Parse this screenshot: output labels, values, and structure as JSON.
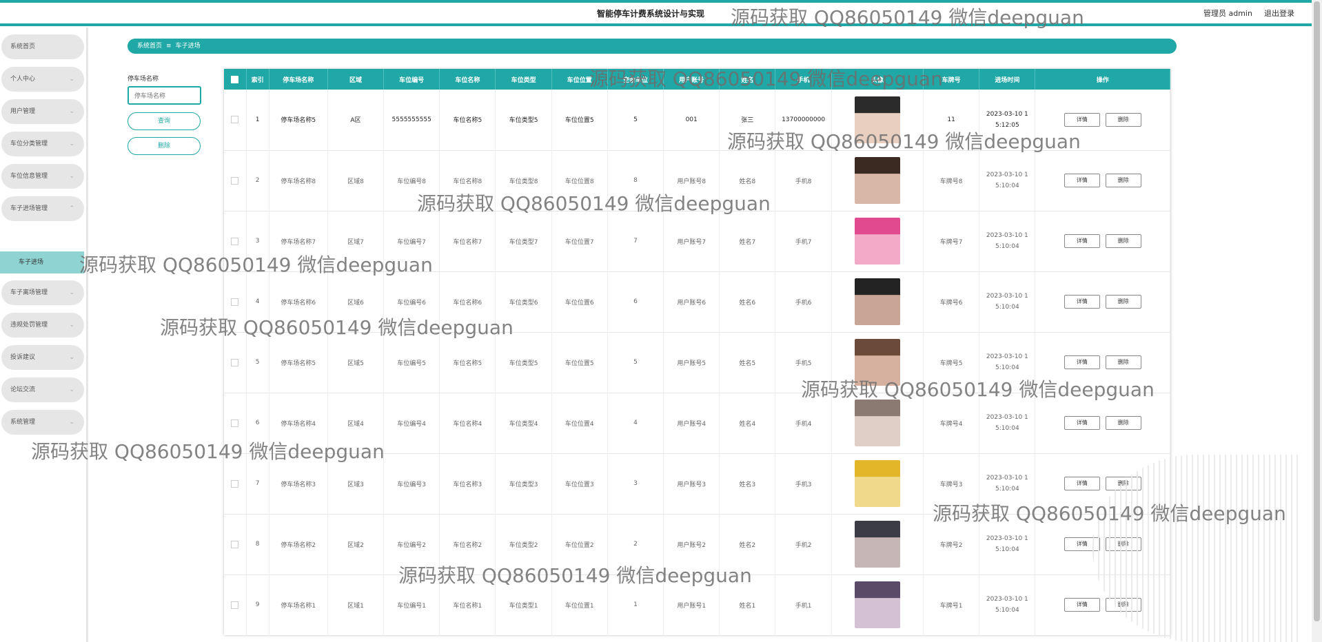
{
  "header": {
    "app_title": "智能停车计费系统设计与实现",
    "user_label": "管理员 admin",
    "logout_label": "退出登录"
  },
  "sidebar": {
    "items": [
      {
        "label": "系统首页",
        "expandable": false
      },
      {
        "label": "个人中心",
        "expandable": true
      },
      {
        "label": "用户管理",
        "expandable": true
      },
      {
        "label": "车位分类管理",
        "expandable": true
      },
      {
        "label": "车位信息管理",
        "expandable": true
      },
      {
        "label": "车子进场管理",
        "expandable": true,
        "expanded": true
      },
      {
        "label": "车子离场管理",
        "expandable": true
      },
      {
        "label": "违规处罚管理",
        "expandable": true
      },
      {
        "label": "投诉建议",
        "expandable": true
      },
      {
        "label": "论坛交流",
        "expandable": true
      },
      {
        "label": "系统管理",
        "expandable": true
      }
    ],
    "active_sub": "车子进场"
  },
  "breadcrumb": {
    "home": "系统首页",
    "current": "车子进场"
  },
  "filter": {
    "label": "停车场名称",
    "placeholder": "停车场名称",
    "search_label": "查询",
    "delete_label": "删除"
  },
  "table": {
    "columns": [
      "",
      "索引",
      "停车场名称",
      "区域",
      "车位编号",
      "车位名称",
      "车位类型",
      "车位位置",
      "空余车位",
      "用户账号",
      "姓名",
      "手机",
      "头像",
      "车牌号",
      "进场时间",
      "操作"
    ],
    "rows": [
      {
        "index": "1",
        "lot": "停车场名称5",
        "area": "A区",
        "code": "5555555555",
        "name": "车位名称5",
        "type": "车位类型5",
        "pos": "车位位置5",
        "free": "5",
        "account": "001",
        "person": "张三",
        "phone": "13700000000",
        "plate": "11",
        "time": "2023-03-10 15:12:05"
      },
      {
        "index": "2",
        "lot": "停车场名称8",
        "area": "区域8",
        "code": "车位编号8",
        "name": "车位名称8",
        "type": "车位类型8",
        "pos": "车位位置8",
        "free": "8",
        "account": "用户账号8",
        "person": "姓名8",
        "phone": "手机8",
        "plate": "车牌号8",
        "time": "2023-03-10 15:10:04"
      },
      {
        "index": "3",
        "lot": "停车场名称7",
        "area": "区域7",
        "code": "车位编号7",
        "name": "车位名称7",
        "type": "车位类型7",
        "pos": "车位位置7",
        "free": "7",
        "account": "用户账号7",
        "person": "姓名7",
        "phone": "手机7",
        "plate": "车牌号7",
        "time": "2023-03-10 15:10:04"
      },
      {
        "index": "4",
        "lot": "停车场名称6",
        "area": "区域6",
        "code": "车位编号6",
        "name": "车位名称6",
        "type": "车位类型6",
        "pos": "车位位置6",
        "free": "6",
        "account": "用户账号6",
        "person": "姓名6",
        "phone": "手机6",
        "plate": "车牌号6",
        "time": "2023-03-10 15:10:04"
      },
      {
        "index": "5",
        "lot": "停车场名称5",
        "area": "区域5",
        "code": "车位编号5",
        "name": "车位名称5",
        "type": "车位类型5",
        "pos": "车位位置5",
        "free": "5",
        "account": "用户账号5",
        "person": "姓名5",
        "phone": "手机5",
        "plate": "车牌号5",
        "time": "2023-03-10 15:10:04"
      },
      {
        "index": "6",
        "lot": "停车场名称4",
        "area": "区域4",
        "code": "车位编号4",
        "name": "车位名称4",
        "type": "车位类型4",
        "pos": "车位位置4",
        "free": "4",
        "account": "用户账号4",
        "person": "姓名4",
        "phone": "手机4",
        "plate": "车牌号4",
        "time": "2023-03-10 15:10:04"
      },
      {
        "index": "7",
        "lot": "停车场名称3",
        "area": "区域3",
        "code": "车位编号3",
        "name": "车位名称3",
        "type": "车位类型3",
        "pos": "车位位置3",
        "free": "3",
        "account": "用户账号3",
        "person": "姓名3",
        "phone": "手机3",
        "plate": "车牌号3",
        "time": "2023-03-10 15:10:04"
      },
      {
        "index": "8",
        "lot": "停车场名称2",
        "area": "区域2",
        "code": "车位编号2",
        "name": "车位名称2",
        "type": "车位类型2",
        "pos": "车位位置2",
        "free": "2",
        "account": "用户账号2",
        "person": "姓名2",
        "phone": "手机2",
        "plate": "车牌号2",
        "time": "2023-03-10 15:10:04"
      },
      {
        "index": "9",
        "lot": "停车场名称1",
        "area": "区域1",
        "code": "车位编号1",
        "name": "车位名称1",
        "type": "车位类型1",
        "pos": "车位位置1",
        "free": "1",
        "account": "用户账号1",
        "person": "姓名1",
        "phone": "手机1",
        "plate": "车牌号1",
        "time": "2023-03-10 15:10:04"
      }
    ],
    "detail_label": "详情",
    "delete_label": "删除"
  },
  "watermark_text": "源码获取 QQ86050149 微信deepguan",
  "colors": {
    "accent": "#20a8a6",
    "sub_active": "#8fd3d2",
    "menu_bg": "#e6e6e6"
  }
}
